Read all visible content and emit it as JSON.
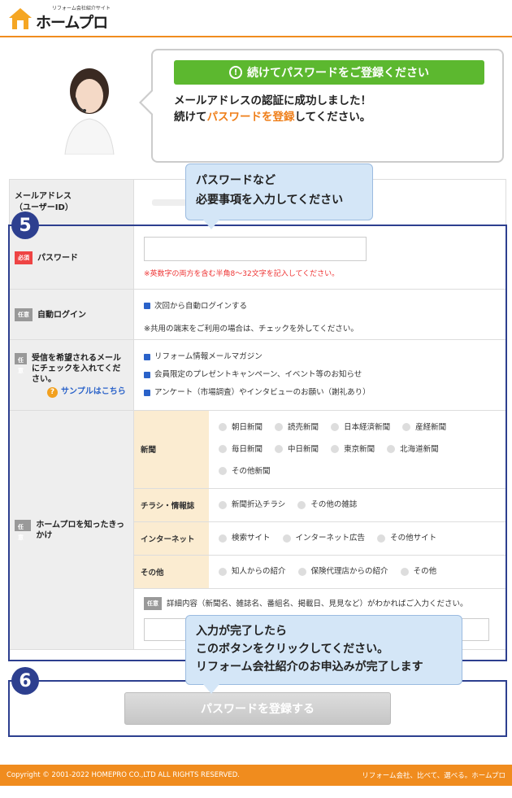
{
  "header": {
    "tagline": "リフォーム会社紹介サイト",
    "logo": "ホームプロ"
  },
  "bubble": {
    "banner": "続けてパスワードをご登録ください",
    "line1": "メールアドレスの認証に成功しました！",
    "line2_a": "続けて",
    "line2_b": "パスワードを登録",
    "line2_c": "してください。"
  },
  "form": {
    "email_label": "メールアドレス\n（ユーザーID）",
    "password": {
      "badge": "必須",
      "label": "パスワード",
      "note": "※英数字の両方を含む半角8～32文字を記入してください。"
    },
    "autologin": {
      "badge": "任意",
      "label": "自動ログイン",
      "checkbox": "次回から自動ログインする",
      "note": "※共用の端末をご利用の場合は、チェックを外してください。"
    },
    "mail": {
      "badge": "任意",
      "label": "受信を希望されるメールにチェックを入れてください。",
      "sample": "サンプルはこちら",
      "items": [
        "リフォーム情報メールマガジン",
        "会員限定のプレゼントキャンペーン、イベント等のお知らせ",
        "アンケート（市場調査）やインタビューのお願い（謝礼あり）"
      ]
    },
    "source": {
      "badge": "任意",
      "label": "ホームプロを知ったきっかけ",
      "groups": [
        {
          "label": "新聞",
          "options": [
            "朝日新聞",
            "読売新聞",
            "日本経済新聞",
            "産経新聞",
            "毎日新聞",
            "中日新聞",
            "東京新聞",
            "北海道新聞",
            "その他新聞"
          ]
        },
        {
          "label": "チラシ・情報誌",
          "options": [
            "新聞折込チラシ",
            "その他の雑誌"
          ]
        },
        {
          "label": "インターネット",
          "options": [
            "検索サイト",
            "インターネット広告",
            "その他サイト"
          ]
        },
        {
          "label": "その他",
          "options": [
            "知人からの紹介",
            "保険代理店からの紹介",
            "その他"
          ]
        }
      ],
      "detail_badge": "任意",
      "detail_text": "詳細内容（新聞名、雑誌名、番組名、掲載日、見見など）がわかればご入力ください。"
    }
  },
  "tips": {
    "step5": "5",
    "step6": "6",
    "tip1_line1": "パスワードなど",
    "tip1_line2": "必要事項を入力してください",
    "tip2_line1": "入力が完了したら",
    "tip2_line2": "このボタンをクリックしてください。",
    "tip2_line3": "リフォーム会社紹介のお申込みが完了します"
  },
  "submit_label": "パスワードを登録する",
  "footer": {
    "copyright": "Copyright © 2001-2022 HOMEPRO CO.,LTD ALL RIGHTS RESERVED.",
    "slogan": "リフォーム会社、比べて、選べる。ホームプロ"
  }
}
